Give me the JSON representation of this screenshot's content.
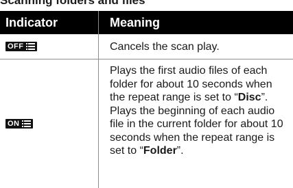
{
  "page_title": "Scanning folders and files",
  "table": {
    "headers": {
      "indicator": "Indicator",
      "meaning": "Meaning"
    },
    "rows": [
      {
        "indicator": "OFF",
        "icon": "list-icon",
        "meaning": "Cancels the scan play."
      },
      {
        "indicator": "ON",
        "icon": "list-icon",
        "meaning_part1": "Plays the first audio files of each folder for about 10 seconds when the repeat range is set to “",
        "meaning_bold1": "Disc",
        "meaning_part2": "”.",
        "meaning_part3": "Plays the beginning of each audio file in the current folder for about 10 seconds when the repeat range is set to “",
        "meaning_bold2": "Folder",
        "meaning_part4": "”."
      }
    ]
  },
  "colors": {
    "header_bg": "#000000",
    "header_text": "#ffffff",
    "badge_bg": "#111111",
    "rule": "#8c8c8c"
  }
}
